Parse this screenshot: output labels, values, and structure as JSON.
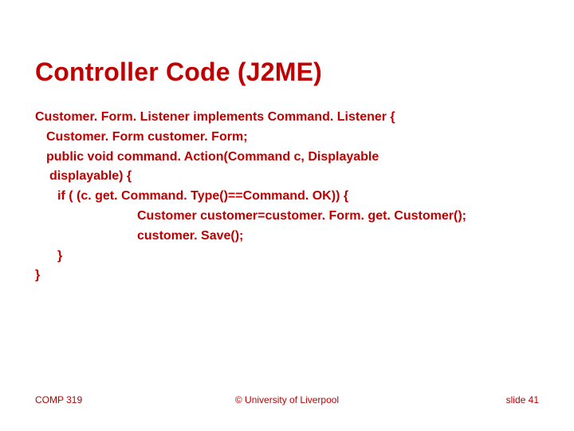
{
  "title": "Controller Code (J2ME)",
  "code": {
    "l1": "Customer. Form. Listener implements Command. Listener {",
    "l2": "Customer. Form customer. Form;",
    "l3": "public void command. Action(Command c, Displayable",
    "l4": "displayable) {",
    "l5": "if ( (c. get. Command. Type()==Command. OK)) {",
    "l6": "Customer customer=customer. Form. get. Customer();",
    "l7": "customer. Save();",
    "l8": "}",
    "l9": "}"
  },
  "footer": {
    "course": "COMP 319",
    "copyright": "© University of Liverpool",
    "slide_label": "slide  41"
  }
}
